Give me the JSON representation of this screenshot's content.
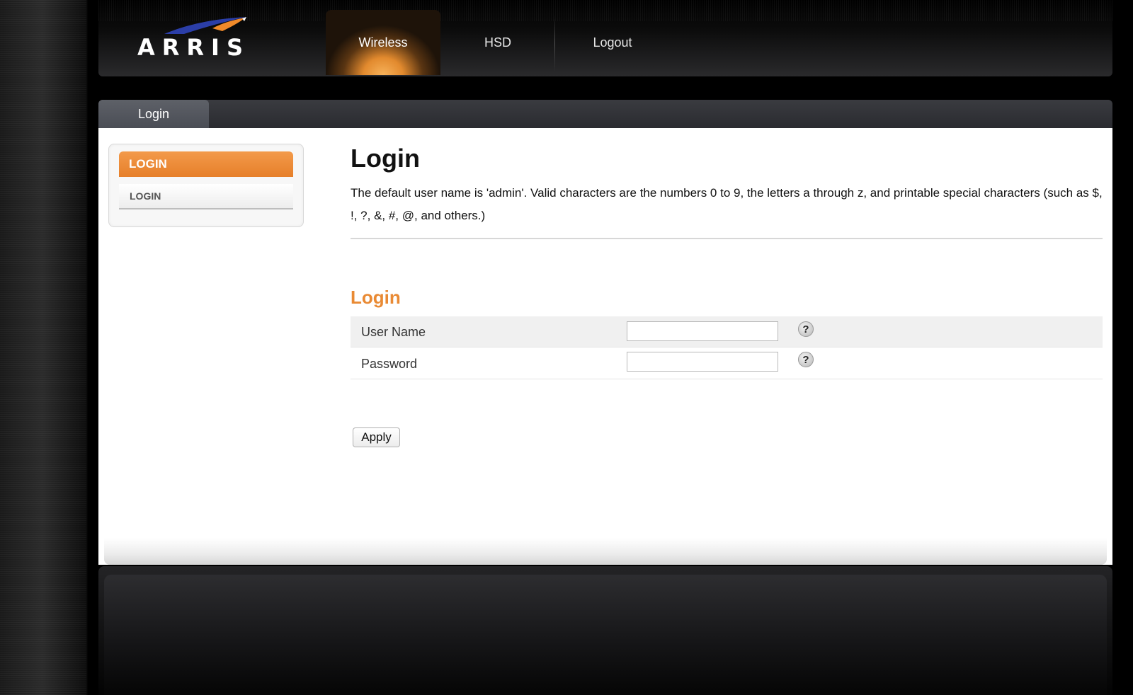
{
  "brand": {
    "logo_text": "ARRIS",
    "colors": {
      "accent": "#e98a34",
      "swoosh_blue": "#2b3ea8",
      "swoosh_orange": "#f08a2a"
    }
  },
  "nav": {
    "tabs": [
      {
        "label": "Wireless",
        "active": true
      },
      {
        "label": "HSD",
        "active": false
      },
      {
        "label": "Logout",
        "active": false
      }
    ]
  },
  "subnav": {
    "active_tab": "Login"
  },
  "sidebar": {
    "header": "LOGIN",
    "items": [
      {
        "label": "LOGIN"
      }
    ]
  },
  "main": {
    "title": "Login",
    "description": "The default user name is 'admin'. Valid characters are the numbers 0 to 9, the letters a through z, and printable special characters (such as $, !, ?, &, #, @, and others.)",
    "section_title": "Login",
    "fields": {
      "username": {
        "label": "User Name",
        "value": "",
        "help_icon": "help-icon"
      },
      "password": {
        "label": "Password",
        "value": "",
        "help_icon": "help-icon"
      }
    },
    "help_glyph": "?",
    "apply_label": "Apply"
  }
}
